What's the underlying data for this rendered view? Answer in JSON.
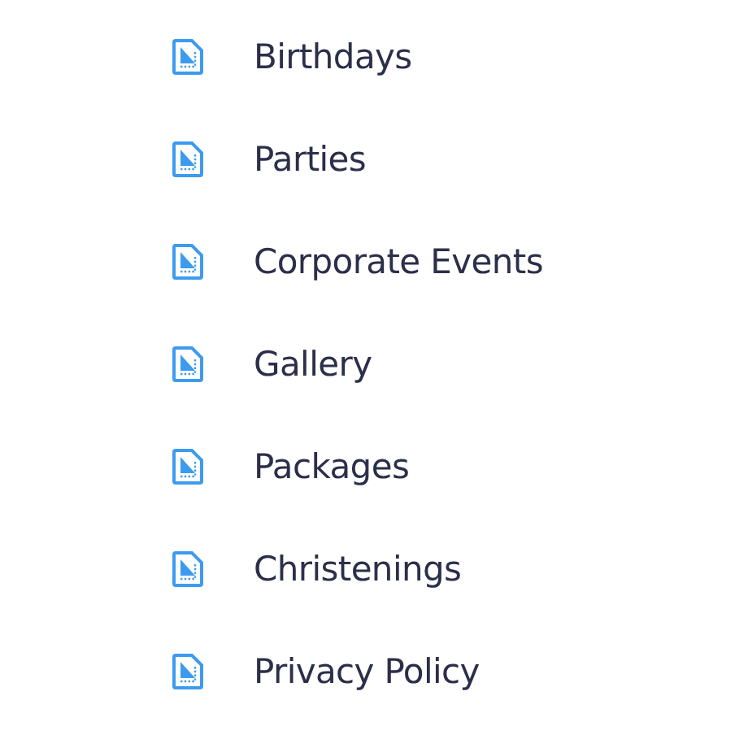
{
  "pages": [
    {
      "label": "Birthdays"
    },
    {
      "label": "Parties"
    },
    {
      "label": "Corporate Events"
    },
    {
      "label": "Gallery"
    },
    {
      "label": "Packages"
    },
    {
      "label": "Christenings"
    },
    {
      "label": "Privacy Policy"
    }
  ]
}
